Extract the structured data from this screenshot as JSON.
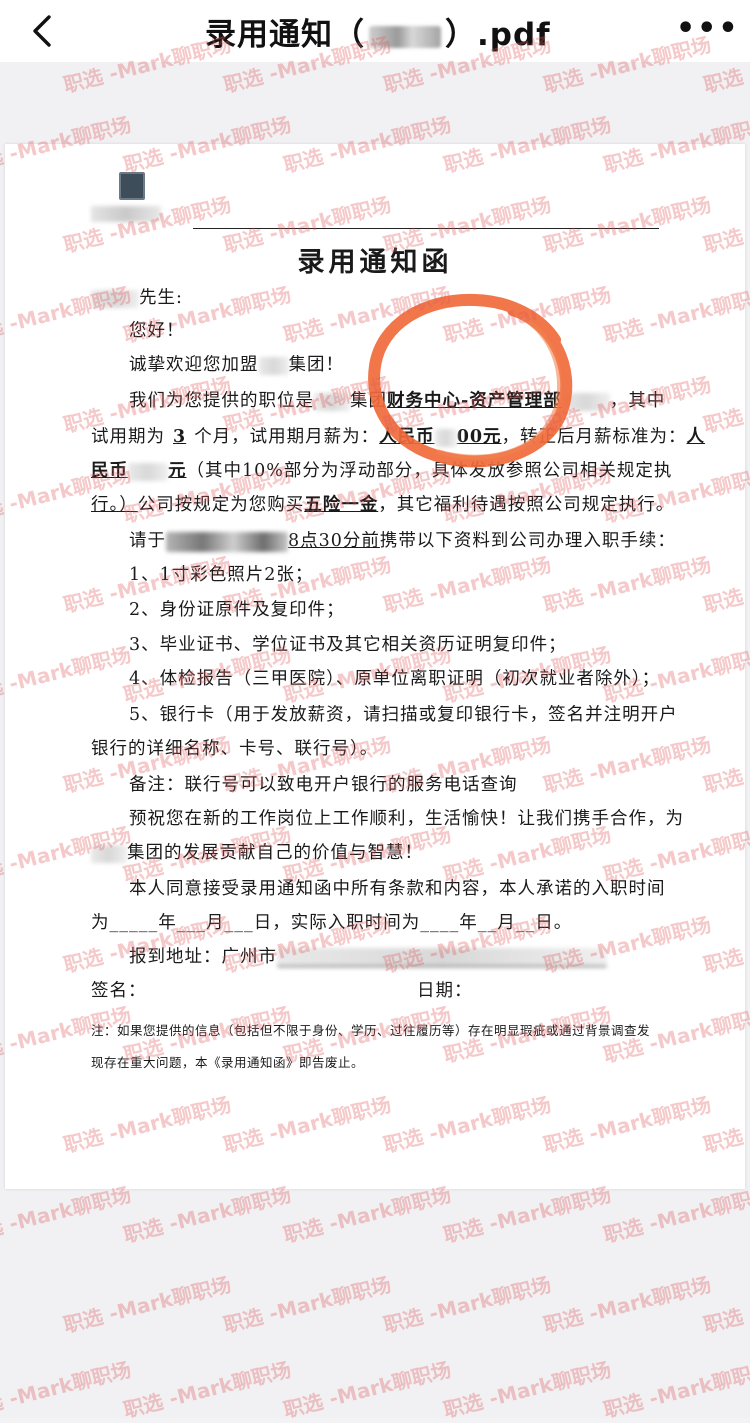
{
  "navbar": {
    "back_icon": "chevron-left-icon",
    "title_prefix": "录用通知（",
    "title_suffix": "）.pdf",
    "more_icon": "more-horizontal-icon",
    "more_label": "•••"
  },
  "document": {
    "title": "录用通知函",
    "greeting_suffix": "先生:",
    "hello": "您好！",
    "welcome_prefix": "诚挚欢迎您加盟",
    "welcome_suffix": "集团！",
    "position_prefix": "我们为您提供的职位是",
    "position_group": "集团",
    "position_dept": "财务中心-资产管理部",
    "position_suffix": "，其中",
    "probation_prefix": "试用期为",
    "probation_months": "3",
    "probation_mid": "个月，试用期月薪为：",
    "probation_salary_a": "人民币",
    "probation_salary_b": "00元",
    "regular_text": "，转正后月薪标准为：",
    "regular_salary_start": "人",
    "regular_salary_cont": "民币",
    "regular_salary_end": "元",
    "float_note": "（其中10%部分为浮动部分，具体发放参照公司相关规定执",
    "float_note_end": "行。）",
    "insurance_prefix": "公司按规定为您购买",
    "insurance": "五险一金",
    "insurance_suffix": "，其它福利待遇按照公司规定执行。",
    "report_prefix": "请于",
    "report_time": "8点30分前",
    "report_suffix": "携带以下资料到公司办理入职手续：",
    "items": [
      "1、1寸彩色照片2张；",
      "2、身份证原件及复印件；",
      "3、毕业证书、学位证书及其它相关资历证明复印件；",
      "4、体检报告（三甲医院）、原单位离职证明（初次就业者除外）；",
      "5、银行卡（用于发放薪资，请扫描或复印银行卡，签名并注明开户",
      "银行的详细名称、卡号、联行号）。"
    ],
    "remark": "备注：联行号可以致电开户银行的服务电话查询",
    "wish_1": "预祝您在新的工作岗位上工作顺利，生活愉快！让我们携手合作，为",
    "wish_2": "集团的发展贡献自己的价值与智慧！",
    "agree_1": "本人同意接受录用通知函中所有条款和内容，本人承诺的入职时间",
    "agree_2": "为_____年___月___日，实际入职时间为____年__月__日。",
    "address_label": "报到地址：广州市",
    "sign_label": "签名：",
    "date_label": "日期：",
    "note_1": "注：如果您提供的信息（包括但不限于身份、学历、过往履历等）存在明显瑕疵或通过背景调查发",
    "note_2": "现存在重大问题，本《录用通知函》即告废止。"
  },
  "watermark": {
    "text": "职选 -Mark聊职场",
    "color": "#e25c5c"
  },
  "annotation_color": "#f06a3a"
}
